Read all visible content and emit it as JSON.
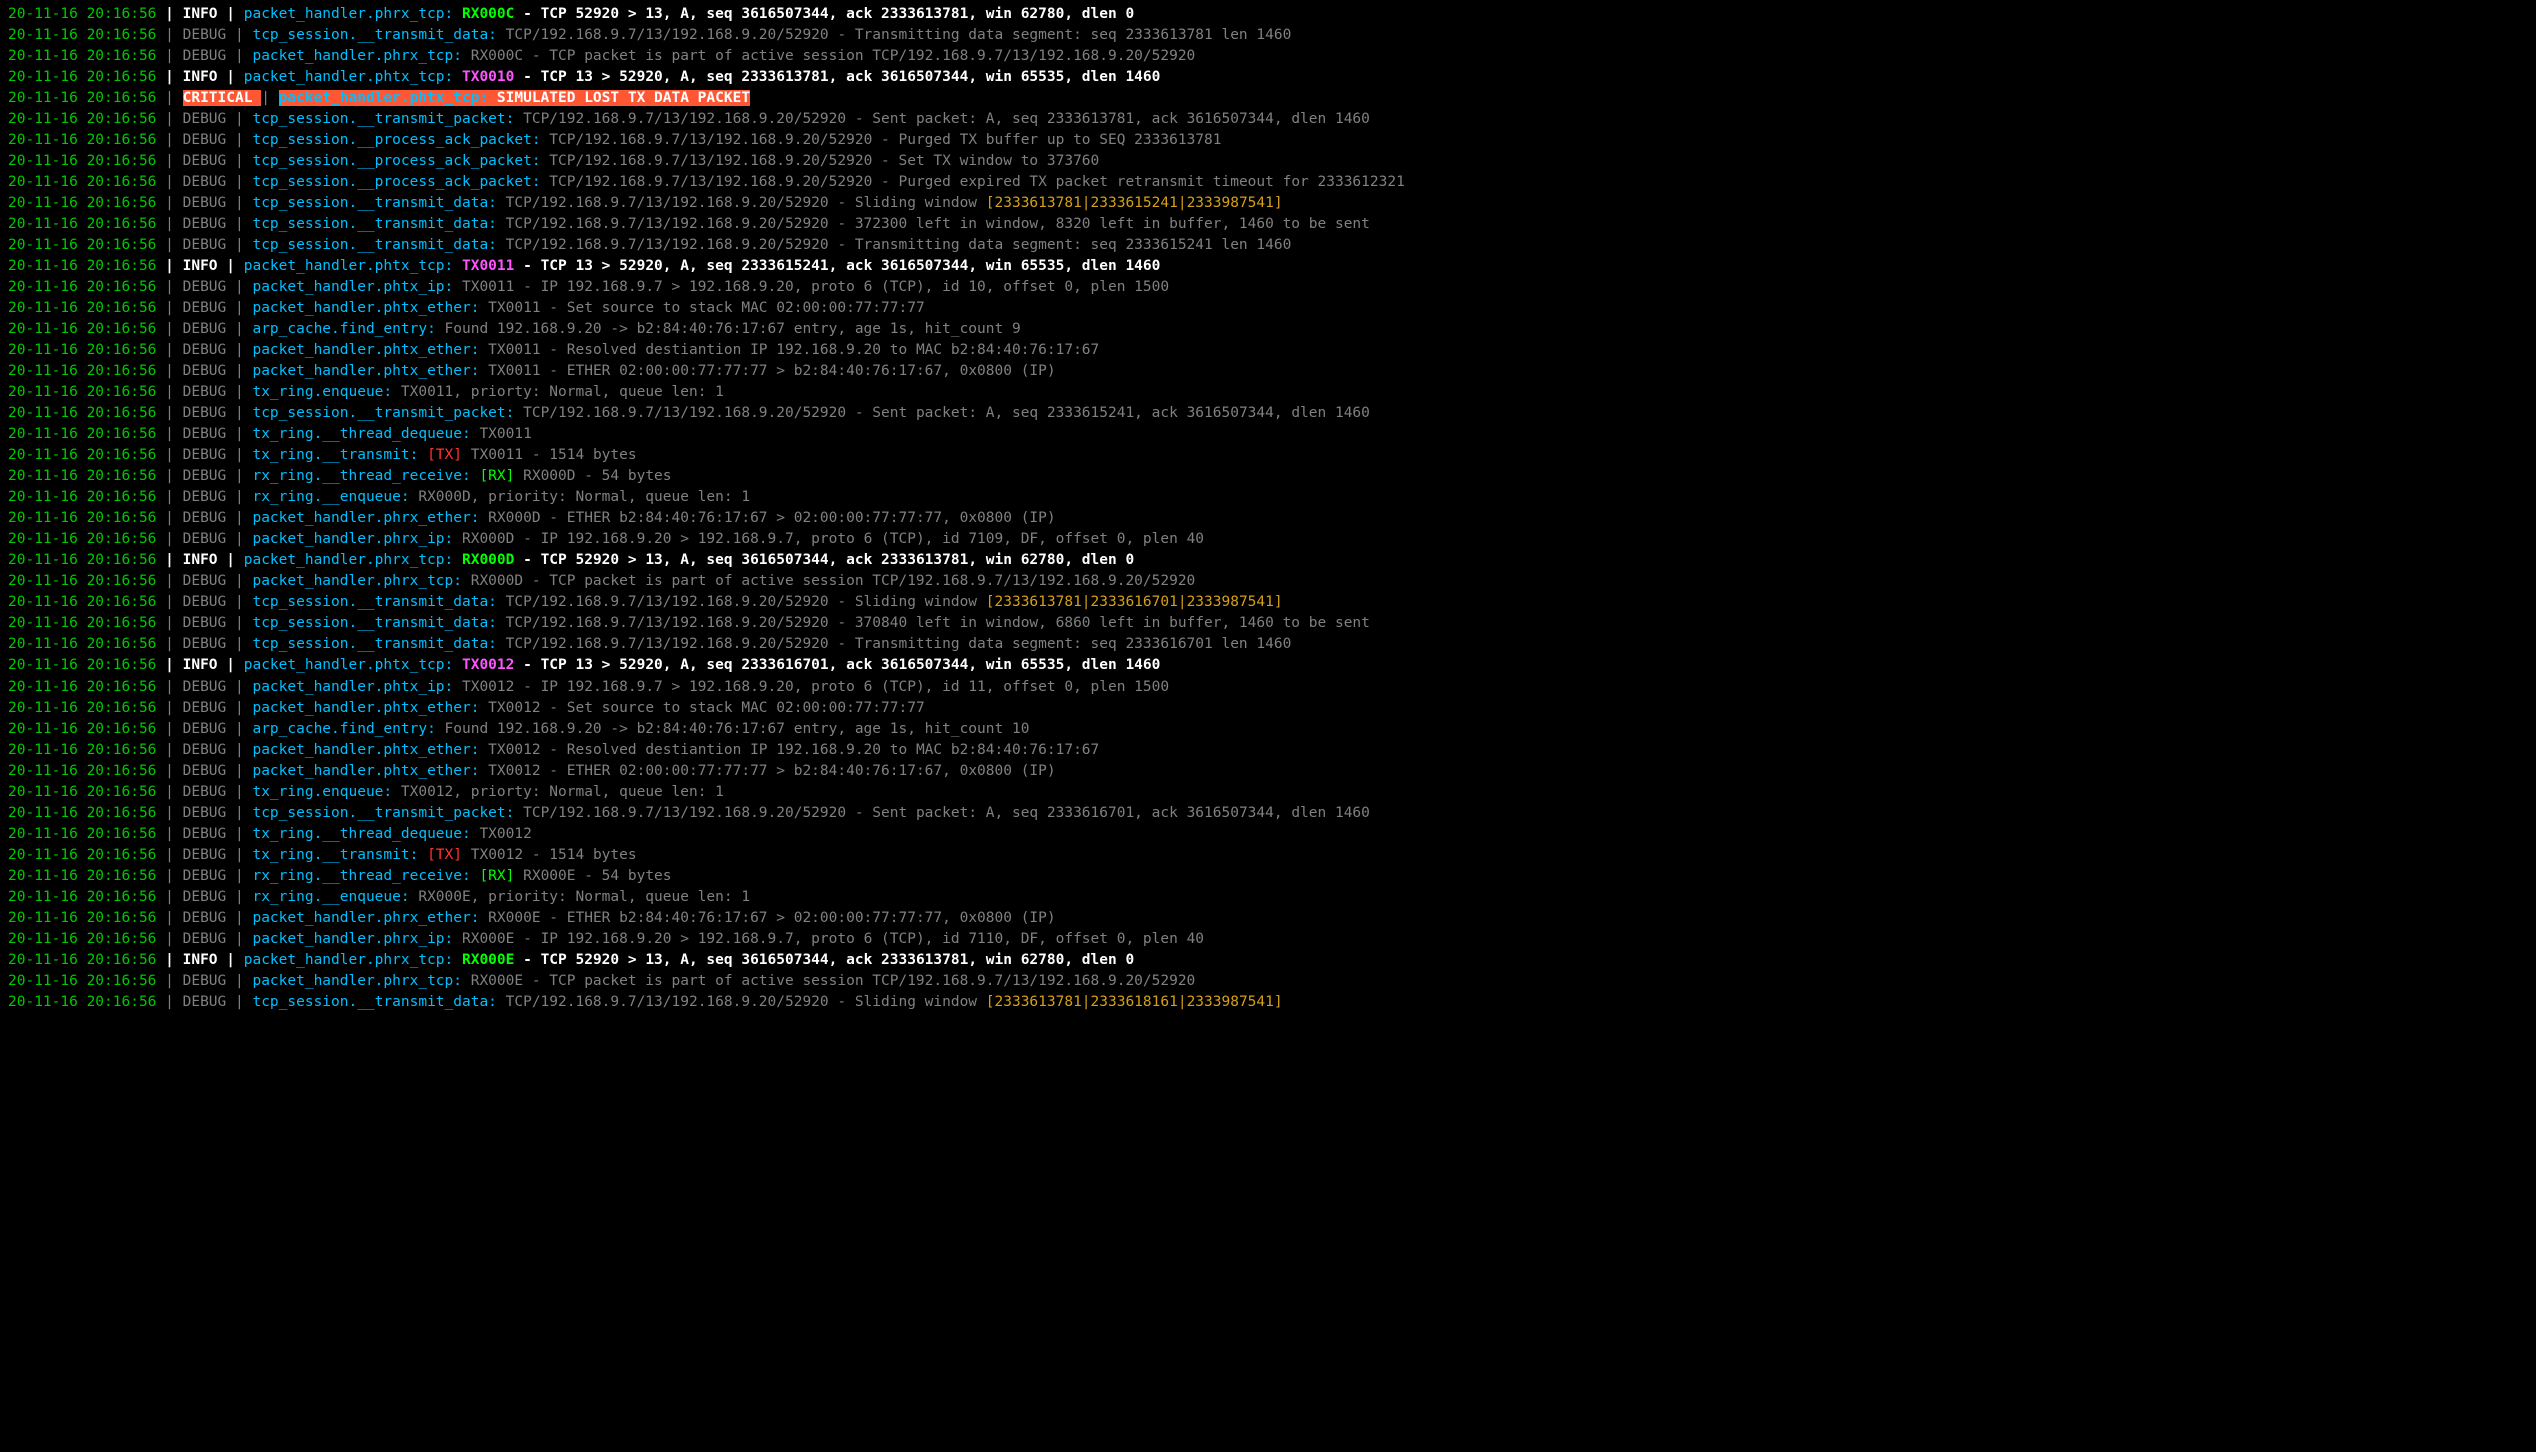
{
  "colors": {
    "background": "#000000",
    "timestamp": "#00c800",
    "info": "#ffffff",
    "debug": "#808080",
    "source": "#00bfff",
    "rx_tag": "#00ff00",
    "tx_tag": "#ff55ff",
    "tx_bracket": "#ff3333",
    "rx_bracket": "#00ff00",
    "window_hl": "#d4a017",
    "critical_bg": "#ff5733"
  },
  "log": [
    {
      "ts": "20-11-16 20:16:56",
      "lvl": "INFO",
      "src": "packet_handler.phrx_tcp:",
      "tag": "RX000C",
      "msg": " - TCP 52920 > 13, A, seq 3616507344, ack 2333613781, win 62780, dlen 0"
    },
    {
      "ts": "20-11-16 20:16:56",
      "lvl": "DEBUG",
      "src": "tcp_session.__transmit_data:",
      "msg": " TCP/192.168.9.7/13/192.168.9.20/52920 - Transmitting data segment: seq 2333613781 len 1460"
    },
    {
      "ts": "20-11-16 20:16:56",
      "lvl": "DEBUG",
      "src": "packet_handler.phrx_tcp:",
      "msg": " RX000C - TCP packet is part of active session TCP/192.168.9.7/13/192.168.9.20/52920"
    },
    {
      "ts": "20-11-16 20:16:56",
      "lvl": "INFO",
      "src": "packet_handler.phtx_tcp:",
      "tag": "TX0010",
      "msg": " - TCP 13 > 52920, A, seq 2333613781, ack 3616507344, win 65535, dlen 1460"
    },
    {
      "ts": "20-11-16 20:16:56",
      "lvl": "CRITICAL",
      "src": " packet_handler.phtx_tcp:",
      "msg": " SIMULATED LOST TX DATA PACKET "
    },
    {
      "ts": "20-11-16 20:16:56",
      "lvl": "DEBUG",
      "src": "tcp_session.__transmit_packet:",
      "msg": " TCP/192.168.9.7/13/192.168.9.20/52920 - Sent packet: A, seq 2333613781, ack 3616507344, dlen 1460"
    },
    {
      "ts": "20-11-16 20:16:56",
      "lvl": "DEBUG",
      "src": "tcp_session.__process_ack_packet:",
      "msg": " TCP/192.168.9.7/13/192.168.9.20/52920 - Purged TX buffer up to SEQ 2333613781"
    },
    {
      "ts": "20-11-16 20:16:56",
      "lvl": "DEBUG",
      "src": "tcp_session.__process_ack_packet:",
      "msg": " TCP/192.168.9.7/13/192.168.9.20/52920 - Set TX window to 373760"
    },
    {
      "ts": "20-11-16 20:16:56",
      "lvl": "DEBUG",
      "src": "tcp_session.__process_ack_packet:",
      "msg": " TCP/192.168.9.7/13/192.168.9.20/52920 - Purged expired TX packet retransmit timeout for 2333612321"
    },
    {
      "ts": "20-11-16 20:16:56",
      "lvl": "DEBUG",
      "src": "tcp_session.__transmit_data:",
      "msg": " TCP/192.168.9.7/13/192.168.9.20/52920 - Sliding window ",
      "win": "[2333613781|2333615241|2333987541]"
    },
    {
      "ts": "20-11-16 20:16:56",
      "lvl": "DEBUG",
      "src": "tcp_session.__transmit_data:",
      "msg": " TCP/192.168.9.7/13/192.168.9.20/52920 - 372300 left in window, 8320 left in buffer, 1460 to be sent"
    },
    {
      "ts": "20-11-16 20:16:56",
      "lvl": "DEBUG",
      "src": "tcp_session.__transmit_data:",
      "msg": " TCP/192.168.9.7/13/192.168.9.20/52920 - Transmitting data segment: seq 2333615241 len 1460"
    },
    {
      "ts": "20-11-16 20:16:56",
      "lvl": "INFO",
      "src": "packet_handler.phtx_tcp:",
      "tag": "TX0011",
      "msg": " - TCP 13 > 52920, A, seq 2333615241, ack 3616507344, win 65535, dlen 1460"
    },
    {
      "ts": "20-11-16 20:16:56",
      "lvl": "DEBUG",
      "src": "packet_handler.phtx_ip:",
      "msg": " TX0011 - IP 192.168.9.7 > 192.168.9.20, proto 6 (TCP), id 10, offset 0, plen 1500"
    },
    {
      "ts": "20-11-16 20:16:56",
      "lvl": "DEBUG",
      "src": "packet_handler.phtx_ether:",
      "msg": " TX0011 - Set source to stack MAC 02:00:00:77:77:77"
    },
    {
      "ts": "20-11-16 20:16:56",
      "lvl": "DEBUG",
      "src": "arp_cache.find_entry:",
      "msg": " Found 192.168.9.20 -> b2:84:40:76:17:67 entry, age 1s, hit_count 9"
    },
    {
      "ts": "20-11-16 20:16:56",
      "lvl": "DEBUG",
      "src": "packet_handler.phtx_ether:",
      "msg": " TX0011 - Resolved destiantion IP 192.168.9.20 to MAC b2:84:40:76:17:67"
    },
    {
      "ts": "20-11-16 20:16:56",
      "lvl": "DEBUG",
      "src": "packet_handler.phtx_ether:",
      "msg": " TX0011 - ETHER 02:00:00:77:77:77 > b2:84:40:76:17:67, 0x0800 (IP)"
    },
    {
      "ts": "20-11-16 20:16:56",
      "lvl": "DEBUG",
      "src": "tx_ring.enqueue:",
      "msg": " TX0011, priorty: Normal, queue len: 1"
    },
    {
      "ts": "20-11-16 20:16:56",
      "lvl": "DEBUG",
      "src": "tcp_session.__transmit_packet:",
      "msg": " TCP/192.168.9.7/13/192.168.9.20/52920 - Sent packet: A, seq 2333615241, ack 3616507344, dlen 1460"
    },
    {
      "ts": "20-11-16 20:16:56",
      "lvl": "DEBUG",
      "src": "tx_ring.__thread_dequeue:",
      "msg": " TX0011"
    },
    {
      "ts": "20-11-16 20:16:56",
      "lvl": "DEBUG",
      "src": "tx_ring.__transmit:",
      "btag": "[TX]",
      "msg": " TX0011 - 1514 bytes"
    },
    {
      "ts": "20-11-16 20:16:56",
      "lvl": "DEBUG",
      "src": "rx_ring.__thread_receive:",
      "btag": "[RX]",
      "msg": " RX000D - 54 bytes"
    },
    {
      "ts": "20-11-16 20:16:56",
      "lvl": "DEBUG",
      "src": "rx_ring.__enqueue:",
      "msg": " RX000D, priority: Normal, queue len: 1"
    },
    {
      "ts": "20-11-16 20:16:56",
      "lvl": "DEBUG",
      "src": "packet_handler.phrx_ether:",
      "msg": " RX000D - ETHER b2:84:40:76:17:67 > 02:00:00:77:77:77, 0x0800 (IP)"
    },
    {
      "ts": "20-11-16 20:16:56",
      "lvl": "DEBUG",
      "src": "packet_handler.phrx_ip:",
      "msg": " RX000D - IP 192.168.9.20 > 192.168.9.7, proto 6 (TCP), id 7109, DF, offset 0, plen 40"
    },
    {
      "ts": "20-11-16 20:16:56",
      "lvl": "INFO",
      "src": "packet_handler.phrx_tcp:",
      "tag": "RX000D",
      "msg": " - TCP 52920 > 13, A, seq 3616507344, ack 2333613781, win 62780, dlen 0"
    },
    {
      "ts": "20-11-16 20:16:56",
      "lvl": "DEBUG",
      "src": "packet_handler.phrx_tcp:",
      "msg": " RX000D - TCP packet is part of active session TCP/192.168.9.7/13/192.168.9.20/52920"
    },
    {
      "ts": "20-11-16 20:16:56",
      "lvl": "DEBUG",
      "src": "tcp_session.__transmit_data:",
      "msg": " TCP/192.168.9.7/13/192.168.9.20/52920 - Sliding window ",
      "win": "[2333613781|2333616701|2333987541]"
    },
    {
      "ts": "20-11-16 20:16:56",
      "lvl": "DEBUG",
      "src": "tcp_session.__transmit_data:",
      "msg": " TCP/192.168.9.7/13/192.168.9.20/52920 - 370840 left in window, 6860 left in buffer, 1460 to be sent"
    },
    {
      "ts": "20-11-16 20:16:56",
      "lvl": "DEBUG",
      "src": "tcp_session.__transmit_data:",
      "msg": " TCP/192.168.9.7/13/192.168.9.20/52920 - Transmitting data segment: seq 2333616701 len 1460"
    },
    {
      "ts": "20-11-16 20:16:56",
      "lvl": "INFO",
      "src": "packet_handler.phtx_tcp:",
      "tag": "TX0012",
      "msg": " - TCP 13 > 52920, A, seq 2333616701, ack 3616507344, win 65535, dlen 1460"
    },
    {
      "ts": "20-11-16 20:16:56",
      "lvl": "DEBUG",
      "src": "packet_handler.phtx_ip:",
      "msg": " TX0012 - IP 192.168.9.7 > 192.168.9.20, proto 6 (TCP), id 11, offset 0, plen 1500"
    },
    {
      "ts": "20-11-16 20:16:56",
      "lvl": "DEBUG",
      "src": "packet_handler.phtx_ether:",
      "msg": " TX0012 - Set source to stack MAC 02:00:00:77:77:77"
    },
    {
      "ts": "20-11-16 20:16:56",
      "lvl": "DEBUG",
      "src": "arp_cache.find_entry:",
      "msg": " Found 192.168.9.20 -> b2:84:40:76:17:67 entry, age 1s, hit_count 10"
    },
    {
      "ts": "20-11-16 20:16:56",
      "lvl": "DEBUG",
      "src": "packet_handler.phtx_ether:",
      "msg": " TX0012 - Resolved destiantion IP 192.168.9.20 to MAC b2:84:40:76:17:67"
    },
    {
      "ts": "20-11-16 20:16:56",
      "lvl": "DEBUG",
      "src": "packet_handler.phtx_ether:",
      "msg": " TX0012 - ETHER 02:00:00:77:77:77 > b2:84:40:76:17:67, 0x0800 (IP)"
    },
    {
      "ts": "20-11-16 20:16:56",
      "lvl": "DEBUG",
      "src": "tx_ring.enqueue:",
      "msg": " TX0012, priorty: Normal, queue len: 1"
    },
    {
      "ts": "20-11-16 20:16:56",
      "lvl": "DEBUG",
      "src": "tcp_session.__transmit_packet:",
      "msg": " TCP/192.168.9.7/13/192.168.9.20/52920 - Sent packet: A, seq 2333616701, ack 3616507344, dlen 1460"
    },
    {
      "ts": "20-11-16 20:16:56",
      "lvl": "DEBUG",
      "src": "tx_ring.__thread_dequeue:",
      "msg": " TX0012"
    },
    {
      "ts": "20-11-16 20:16:56",
      "lvl": "DEBUG",
      "src": "tx_ring.__transmit:",
      "btag": "[TX]",
      "msg": " TX0012 - 1514 bytes"
    },
    {
      "ts": "20-11-16 20:16:56",
      "lvl": "DEBUG",
      "src": "rx_ring.__thread_receive:",
      "btag": "[RX]",
      "msg": " RX000E - 54 bytes"
    },
    {
      "ts": "20-11-16 20:16:56",
      "lvl": "DEBUG",
      "src": "rx_ring.__enqueue:",
      "msg": " RX000E, priority: Normal, queue len: 1"
    },
    {
      "ts": "20-11-16 20:16:56",
      "lvl": "DEBUG",
      "src": "packet_handler.phrx_ether:",
      "msg": " RX000E - ETHER b2:84:40:76:17:67 > 02:00:00:77:77:77, 0x0800 (IP)"
    },
    {
      "ts": "20-11-16 20:16:56",
      "lvl": "DEBUG",
      "src": "packet_handler.phrx_ip:",
      "msg": " RX000E - IP 192.168.9.20 > 192.168.9.7, proto 6 (TCP), id 7110, DF, offset 0, plen 40"
    },
    {
      "ts": "20-11-16 20:16:56",
      "lvl": "INFO",
      "src": "packet_handler.phrx_tcp:",
      "tag": "RX000E",
      "msg": " - TCP 52920 > 13, A, seq 3616507344, ack 2333613781, win 62780, dlen 0"
    },
    {
      "ts": "20-11-16 20:16:56",
      "lvl": "DEBUG",
      "src": "packet_handler.phrx_tcp:",
      "msg": " RX000E - TCP packet is part of active session TCP/192.168.9.7/13/192.168.9.20/52920"
    },
    {
      "ts": "20-11-16 20:16:56",
      "lvl": "DEBUG",
      "src": "tcp_session.__transmit_data:",
      "msg": " TCP/192.168.9.7/13/192.168.9.20/52920 - Sliding window ",
      "win": "[2333613781|2333618161|2333987541]"
    }
  ]
}
